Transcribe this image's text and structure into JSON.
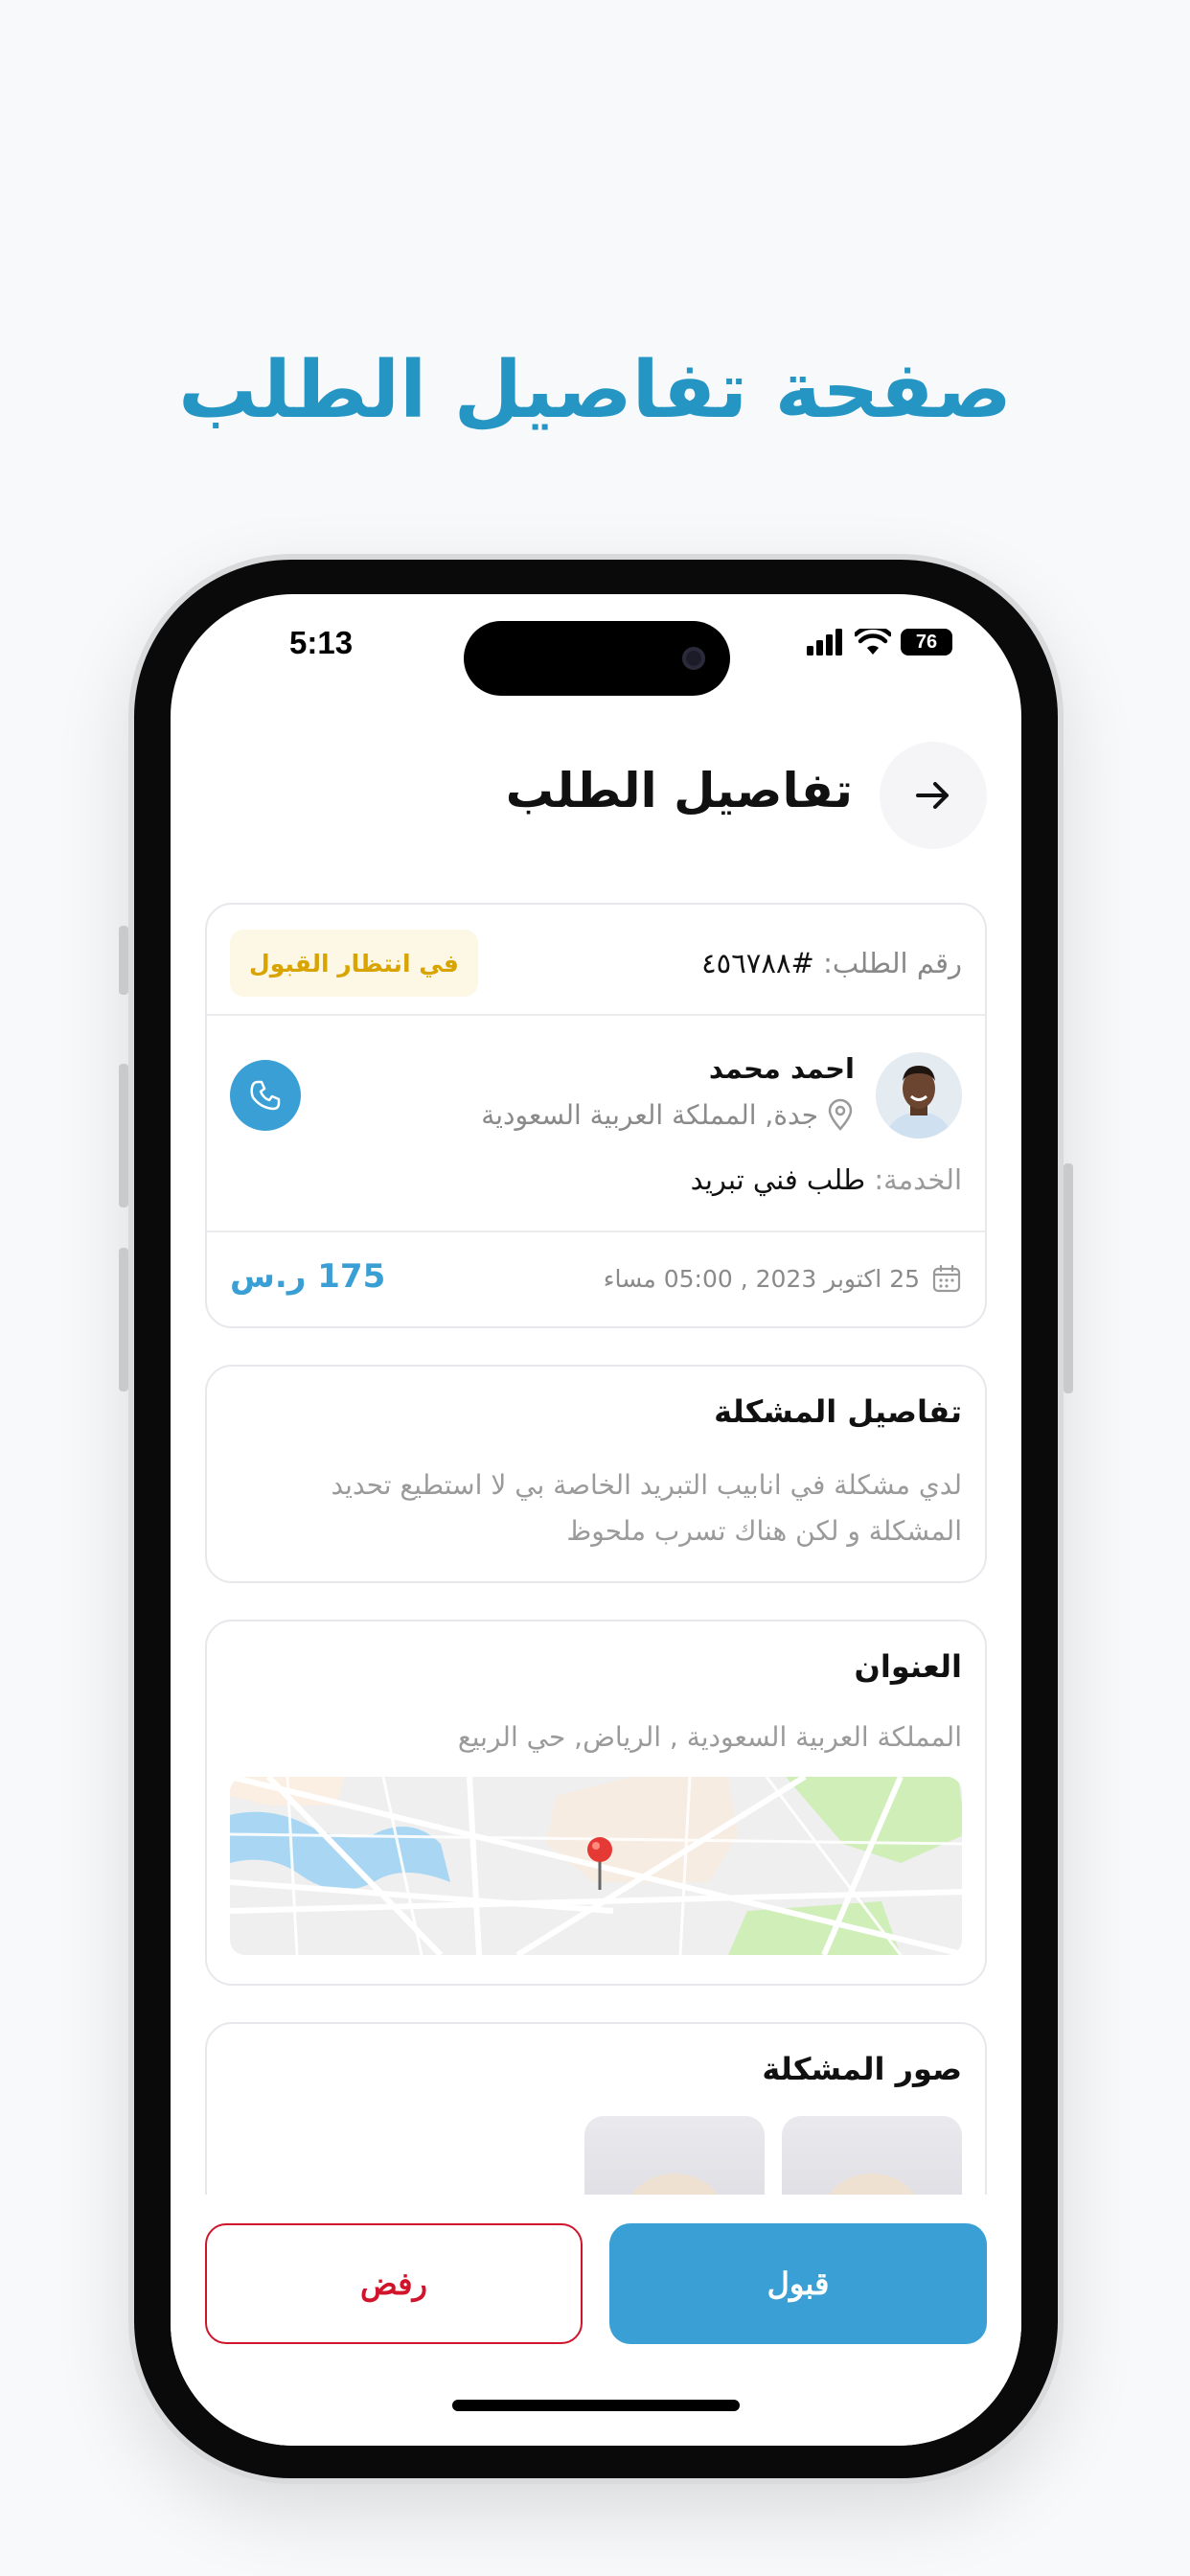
{
  "hero": {
    "title": "صفحة تفاصيل الطلب"
  },
  "status_bar": {
    "time": "5:13",
    "battery": "76"
  },
  "header": {
    "title": "تفاصيل الطلب"
  },
  "order": {
    "number_label": "رقم الطلب:",
    "number_value": "#٤٥٦٧٨٨",
    "status": "في انتظار القبول",
    "customer_name": "احمد محمد",
    "customer_location": "جدة, المملكة العربية السعودية",
    "service_label": "الخدمة:",
    "service_value": "طلب فني تبريد",
    "datetime": "25 اكتوبر 2023 , 05:00 مساء",
    "price": "175 ر.س"
  },
  "problem": {
    "title": "تفاصيل المشكلة",
    "text": "لدي مشكلة في انابيب التبريد الخاصة بي لا استطيع تحديد المشكلة و لكن هناك تسرب ملحوظ"
  },
  "address": {
    "title": "العنوان",
    "text": "المملكة العربية السعودية , الرياض, حي الربيع"
  },
  "images": {
    "title": "صور المشكلة"
  },
  "actions": {
    "accept": "قبول",
    "reject": "رفض"
  },
  "colors": {
    "accent": "#3a9fd5",
    "hero": "#2596c4",
    "pending": "#d9a400",
    "danger": "#d0142b"
  }
}
